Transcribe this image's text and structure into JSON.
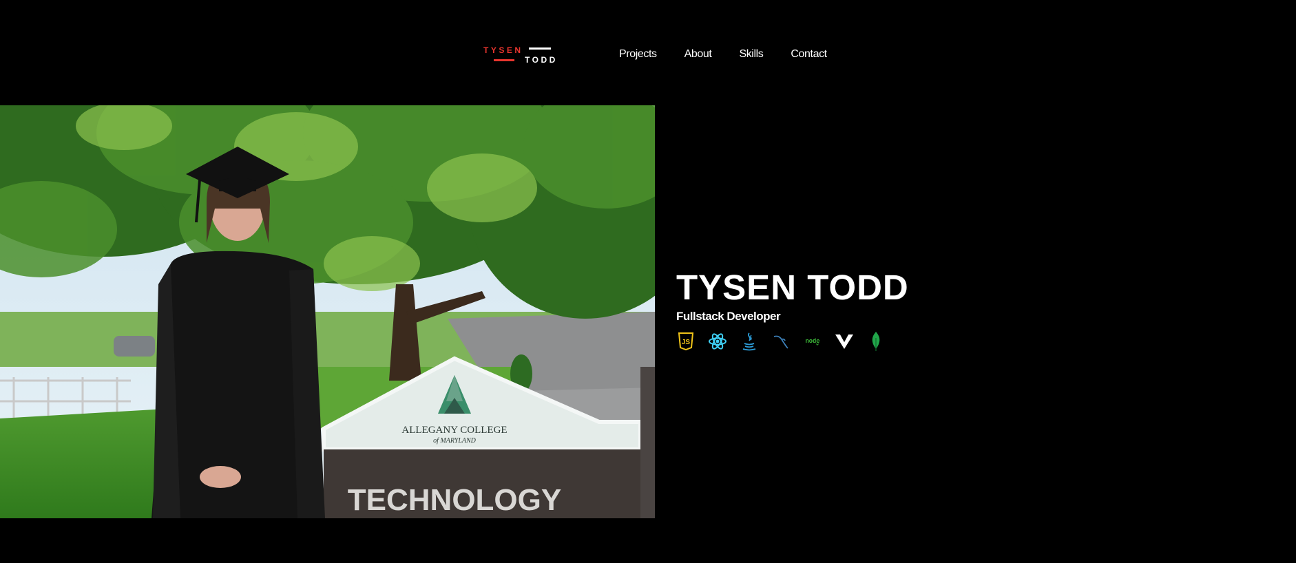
{
  "header": {
    "logo": {
      "top": "TYSEN",
      "bottom": "TODD"
    },
    "nav": [
      {
        "label": "Projects"
      },
      {
        "label": "About"
      },
      {
        "label": "Skills"
      },
      {
        "label": "Contact"
      }
    ]
  },
  "hero": {
    "photo": {
      "sign_name": "ALLEGANY COLLEGE",
      "sign_sub": "of MARYLAND",
      "sign_building": "TECHNOLOGY"
    },
    "name": "TYSEN TODD",
    "role": "Fullstack Developer",
    "tech_icons": [
      "javascript-icon",
      "react-icon",
      "java-icon",
      "mysql-icon",
      "nodejs-icon",
      "vue-icon",
      "mongodb-icon"
    ]
  },
  "colors": {
    "background": "#000000",
    "accent": "#e8352e",
    "text": "#ffffff"
  }
}
